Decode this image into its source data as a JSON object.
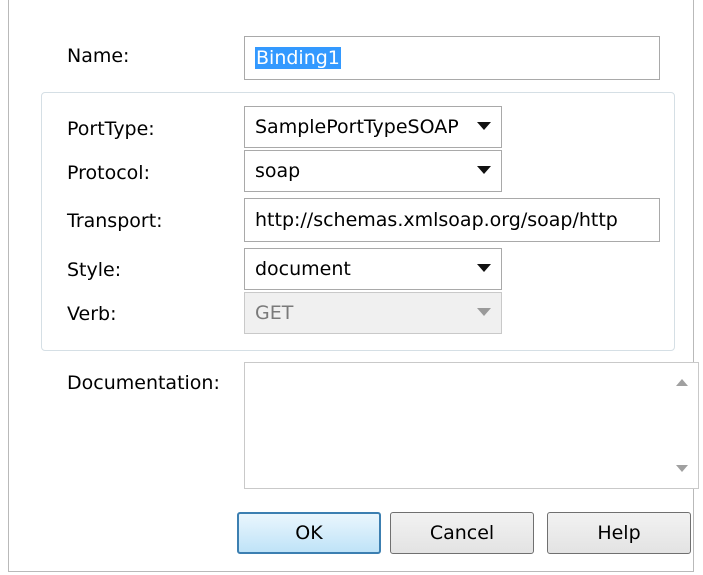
{
  "form": {
    "name_label": "Name:",
    "name_value": "Binding1",
    "porttype_label": "PortType:",
    "porttype_value": "SamplePortTypeSOAP",
    "protocol_label": "Protocol:",
    "protocol_value": "soap",
    "transport_label": "Transport:",
    "transport_value": "http://schemas.xmlsoap.org/soap/http",
    "style_label": "Style:",
    "style_value": "document",
    "verb_label": "Verb:",
    "verb_value": "GET",
    "documentation_label": "Documentation:",
    "documentation_value": ""
  },
  "buttons": {
    "ok": "OK",
    "cancel": "Cancel",
    "help": "Help"
  },
  "colors": {
    "selection": "#3399ff",
    "default_button_border": "#3c7fb1",
    "group_border": "#d5dfe5"
  },
  "icons": {
    "dropdown": "chevron-down-icon",
    "scroll_up": "scroll-up-icon",
    "scroll_down": "scroll-down-icon"
  }
}
